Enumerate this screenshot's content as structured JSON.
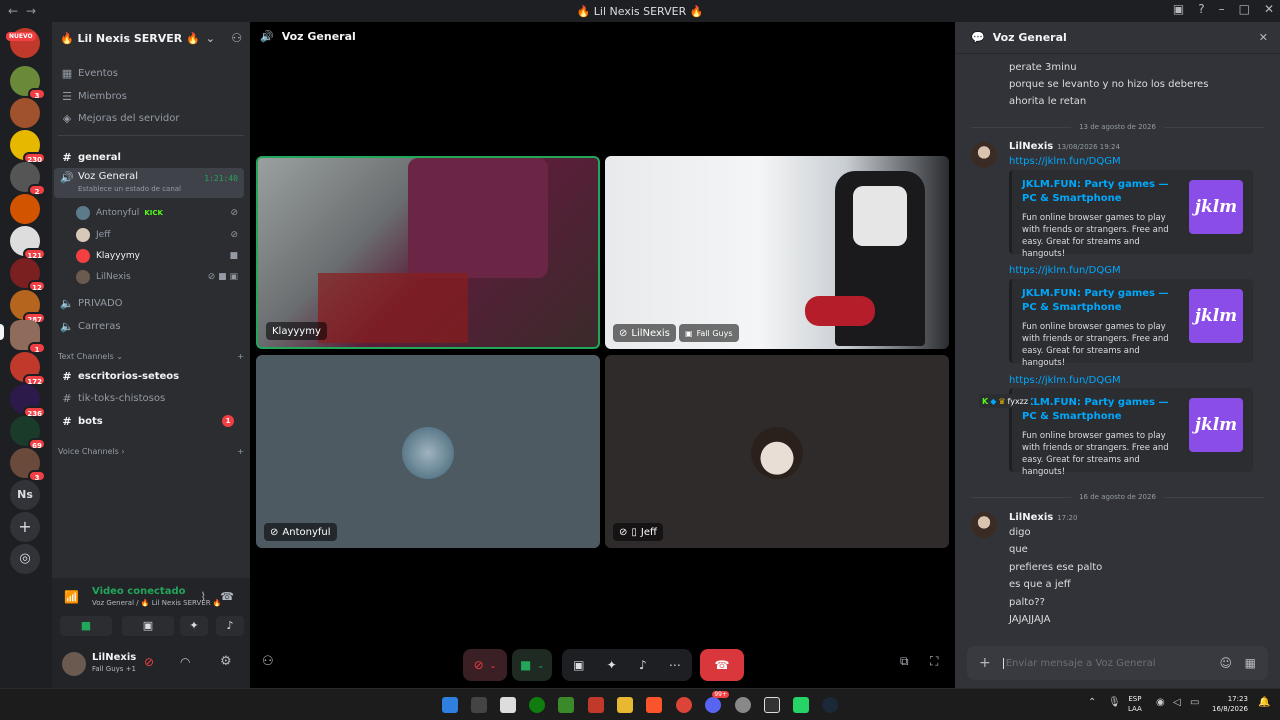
{
  "window": {
    "title": "🔥 Lil Nexis SERVER 🔥"
  },
  "rail": {
    "new_label": "NUEVO",
    "badges": [
      "3",
      "230",
      "2",
      "121",
      "12",
      "287",
      "1",
      "172",
      "236",
      "69",
      "3"
    ],
    "ns_label": "Ns"
  },
  "sidebar": {
    "server_name": "🔥 Lil Nexis SERVER 🔥",
    "top_items": [
      "Eventos",
      "Miembros",
      "Mejoras del servidor"
    ],
    "channels": {
      "general": "general",
      "voz_general": "Voz General",
      "voz_timer": "1:21:40",
      "voz_status": "Establece un estado de canal",
      "privado": "PRIVADO",
      "carreras": "Carreras",
      "text_category": "Text Channels",
      "escritorios": "escritorios-seteos",
      "tiktoks": "tik-toks-chistosos",
      "bots": "bots",
      "bots_badge": "1",
      "voice_category": "Voice Channels"
    },
    "voice_users": [
      {
        "name": "Antonyful",
        "tag": "KICK"
      },
      {
        "name": "Jeff"
      },
      {
        "name": "Klayyymy"
      },
      {
        "name": "LilNexis"
      }
    ],
    "voice_panel": {
      "status": "Video conectado",
      "location": "Voz General / 🔥 Lil Nexis SERVER 🔥"
    },
    "user": {
      "name": "LilNexis",
      "activity": "Fall Guys +1"
    }
  },
  "stage": {
    "header": "Voz General",
    "tiles": [
      {
        "name": "Klayyymy"
      },
      {
        "name": "LilNexis",
        "activity": "Fall Guys"
      },
      {
        "name": "Antonyful"
      },
      {
        "name": "Jeff"
      }
    ]
  },
  "chat": {
    "title": "Voz General",
    "lines_top": [
      "perate 3minu",
      "porque se levanto y no hizo los deberes",
      "ahorita le retan"
    ],
    "date1": "13 de agosto de 2026",
    "msg1": {
      "author": "LilNexis",
      "time": "13/08/2026 19:24"
    },
    "link": "https://jklm.fun/DQGM",
    "embed": {
      "title": "JKLM.FUN: Party games — PC & Smartphone",
      "desc": "Fun online browser games to play with friends or strangers. Free and easy. Great for streams and hangouts!",
      "thumb": "jklm"
    },
    "date2": "16 de agosto de 2026",
    "msg2": {
      "author": "LilNexis",
      "time": "17:20"
    },
    "lines_bottom": [
      "digo",
      "que",
      "prefieres ese palto",
      "es que a jeff",
      "palto??",
      "JAJAJJAJA"
    ],
    "input_placeholder": "Enviar mensaje a Voz General",
    "reaction_label": "fyxzz"
  },
  "taskbar": {
    "lang": "ESP",
    "region": "LAA",
    "time": "17:23",
    "date": "16/8/2026",
    "discord_badge": "99+"
  },
  "colors": {
    "accent": "#23a55a",
    "link": "#00a8fc",
    "danger": "#da373c",
    "embed_thumb": "#8b4de8"
  }
}
